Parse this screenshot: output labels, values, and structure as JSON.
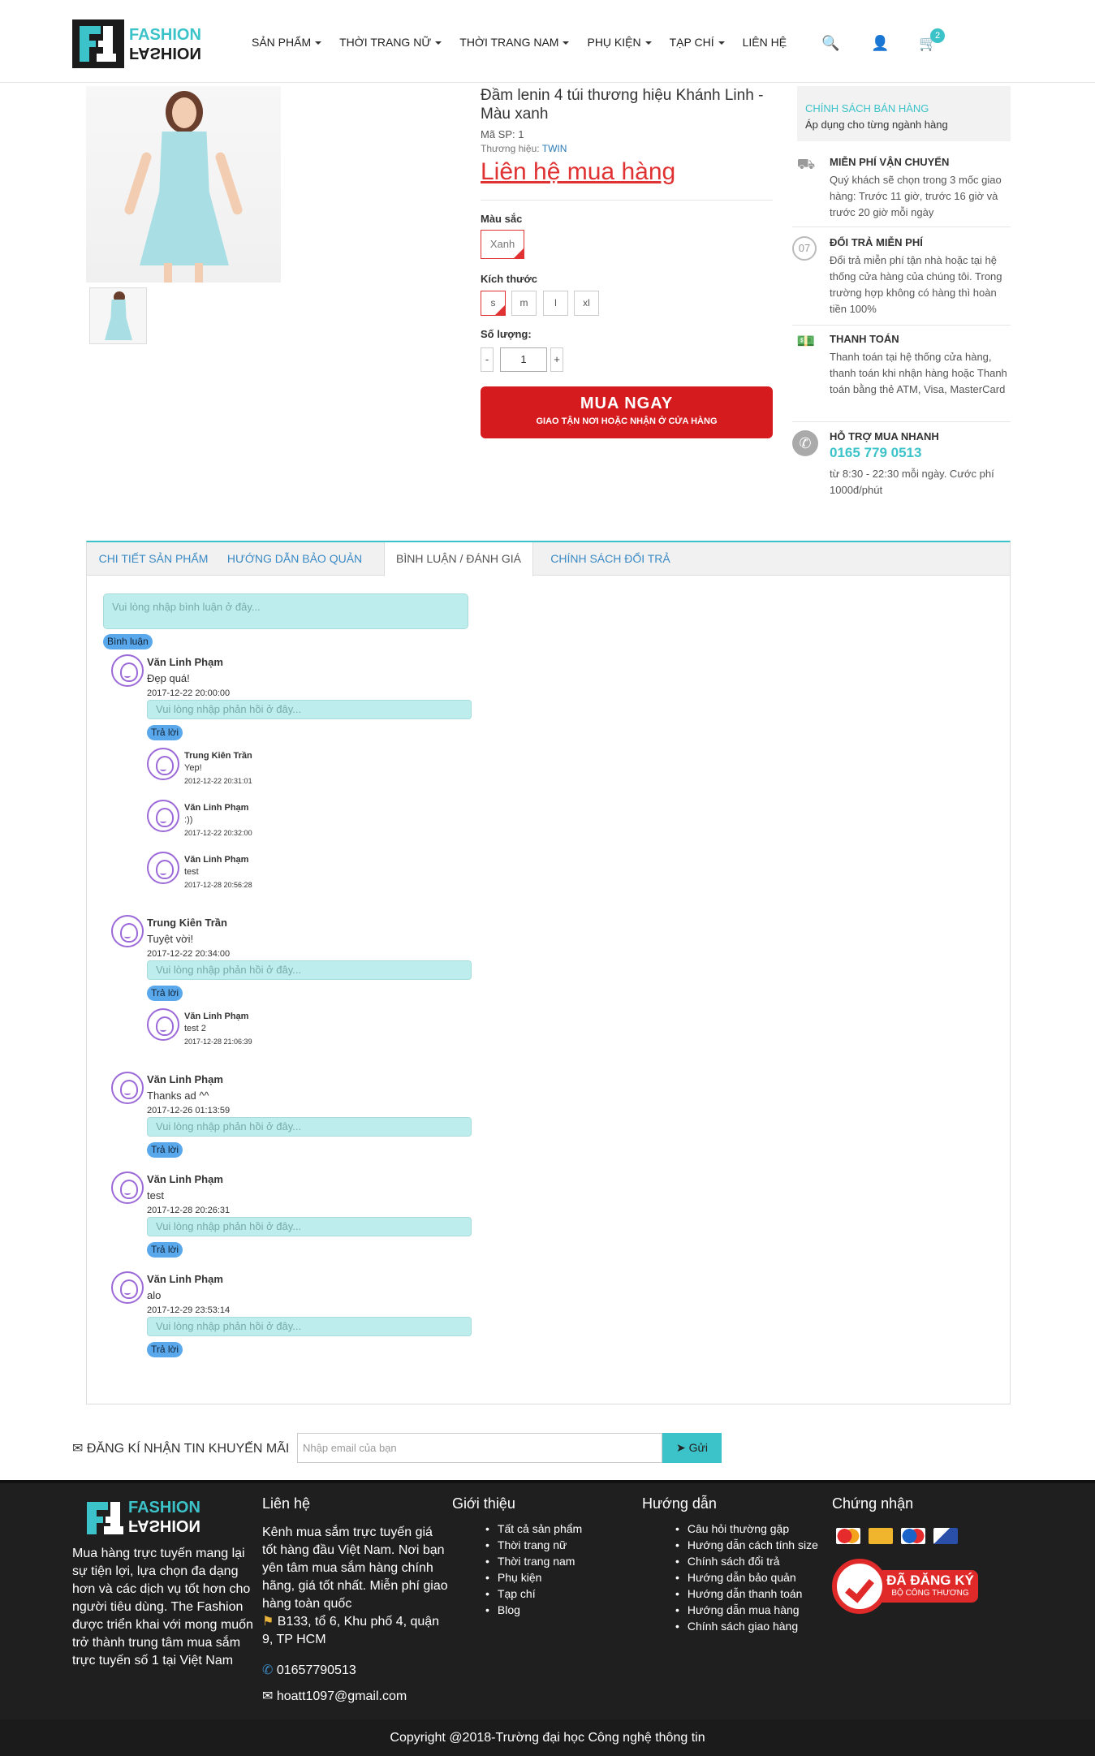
{
  "header": {
    "logo_top": "FASHION",
    "logo_bottom": "FASHION",
    "nav": [
      {
        "label": "SẢN PHẨM",
        "caret": true
      },
      {
        "label": "THỜI TRANG NỮ",
        "caret": true
      },
      {
        "label": "THỜI TRANG NAM",
        "caret": true
      },
      {
        "label": "PHỤ KIỆN",
        "caret": true
      },
      {
        "label": "TẠP CHÍ",
        "caret": true
      },
      {
        "label": "LIÊN HỆ",
        "caret": false
      }
    ],
    "cart_count": "2",
    "icons": [
      "search-icon",
      "user-icon",
      "cart-icon"
    ]
  },
  "product": {
    "title": "Đầm lenin 4 túi thương hiệu Khánh Linh - Màu xanh",
    "code": "Mã SP: 1",
    "brand_label": "Thương hiệu: ",
    "brand": "TWIN",
    "price": "Liên hệ mua hàng",
    "color_label": "Màu sắc",
    "color": "Xanh",
    "size_label": "Kích thước",
    "sizes": [
      "s",
      "m",
      "l",
      "xl"
    ],
    "qty_label": "Số lượng:",
    "qty_minus": "-",
    "qty_value": "1",
    "qty_plus": "+",
    "buy_main": "MUA NGAY",
    "buy_sub": "GIAO TẬN NƠI HOẶC NHẬN Ở CỬA HÀNG"
  },
  "policy": {
    "title": "CHÍNH SÁCH BÁN HÀNG",
    "subtitle": "Áp dụng cho từng ngành hàng",
    "items": [
      {
        "icon": "truck-icon",
        "title": "MIỄN PHÍ VẬN CHUYỂN",
        "desc": "Quý khách sẽ chọn trong 3 mốc giao hàng: Trước 11 giờ, trước 16 giờ và trước 20 giờ mỗi ngày"
      },
      {
        "icon": "return-icon",
        "title": "ĐỔI TRẢ MIỄN PHÍ",
        "desc": "Đổi trả miễn phí tận nhà hoặc tại hệ thống cửa hàng của chúng tôi. Trong trường hợp không có hàng thì hoàn tiền 100%"
      },
      {
        "icon": "payment-icon",
        "title": "THANH TOÁN",
        "desc": "Thanh toán tại hệ thống cửa hàng, thanh toán khi nhận hàng hoặc Thanh toán bằng thẻ ATM, Visa, MasterCard"
      },
      {
        "icon": "phone-icon",
        "title": "HỖ TRỢ MUA NHANH",
        "phone": "0165 779 0513",
        "desc": "từ 8:30 - 22:30 mỗi ngày. Cước phí 1000đ/phút"
      }
    ]
  },
  "tabs": [
    "CHI TIẾT SẢN PHẨM",
    "HƯỚNG DẪN BẢO QUẢN",
    "BÌNH LUẬN / ĐÁNH GIÁ",
    "CHÍNH SÁCH ĐỔI TRẢ"
  ],
  "comments_section": {
    "placeholder": "Vui lòng nhập bình luận ở đây...",
    "submit": "Bình luận",
    "reply_placeholder": "Vui lòng nhập phản hồi ở đây...",
    "reply_button": "Trả lời",
    "comments": [
      {
        "name": "Văn Linh Phạm",
        "text": "Đẹp quá!",
        "date": "2017-12-22 20:00:00",
        "replies": [
          {
            "name": "Trung Kiên Trần",
            "text": "Yep!",
            "date": "2012-12-22 20:31:01"
          },
          {
            "name": "Văn Linh Phạm",
            "text": ":))",
            "date": "2017-12-22 20:32:00"
          },
          {
            "name": "Văn Linh Phạm",
            "text": "test",
            "date": "2017-12-28 20:56:28"
          }
        ]
      },
      {
        "name": "Trung Kiên Trần",
        "text": "Tuyệt vời!",
        "date": "2017-12-22 20:34:00",
        "replies": [
          {
            "name": "Văn Linh Phạm",
            "text": "test 2",
            "date": "2017-12-28 21:06:39"
          }
        ]
      },
      {
        "name": "Văn Linh Phạm",
        "text": "Thanks ad ^^",
        "date": "2017-12-26 01:13:59",
        "replies": []
      },
      {
        "name": "Văn Linh Phạm",
        "text": "test",
        "date": "2017-12-28 20:26:31",
        "replies": []
      },
      {
        "name": "Văn Linh Phạm",
        "text": "alo",
        "date": "2017-12-29 23:53:14",
        "replies": []
      }
    ]
  },
  "newsletter": {
    "label": "ĐĂNG KÍ NHẬN TIN KHUYẾN MÃI",
    "placeholder": "Nhập email của bạn",
    "button": "Gửi"
  },
  "footer": {
    "about": "Mua hàng trực tuyến mang lại sự tiện lợi, lựa chọn đa dạng hơn và các dịch vụ tốt hơn cho người tiêu dùng. The Fashion được triển khai với mong muốn trở thành trung tâm mua sắm trực tuyến số 1 tại Việt Nam",
    "contact_title": "Liên hệ",
    "contact_desc": "Kênh mua sắm trực tuyến giá tốt hàng đầu Việt Nam. Nơi bạn yên tâm mua sắm hàng chính hãng, giá tốt nhất. Miễn phí giao hàng toàn quốc",
    "address": "B133, tổ 6, Khu phố 4, quận 9, TP HCM",
    "phone": "01657790513",
    "email": "hoatt1097@gmail.com",
    "intro_title": "Giới thiệu",
    "intro_links": [
      "Tất cả sản phẩm",
      "Thời trang nữ",
      "Thời trang nam",
      "Phụ kiện",
      "Tạp chí",
      "Blog"
    ],
    "guide_title": "Hướng dẫn",
    "guide_links": [
      "Câu hỏi thường gặp",
      "Hướng dẫn cách tính size",
      "Chính sách đổi trả",
      "Hướng dẫn bảo quản",
      "Hướng dẫn thanh toán",
      "Hướng dẫn mua hàng",
      "Chính sách giao hàng"
    ],
    "cert_title": "Chứng nhận",
    "cert_main": "ĐÃ ĐĂNG KÝ",
    "cert_sub": "BỘ CÔNG THƯƠNG",
    "copyright": "Copyright @2018-Trường đại học Công nghệ thông tin"
  },
  "colors": {
    "accent": "#3cc3c9",
    "buy": "#d61b1f",
    "price": "#e03232",
    "link": "#3a8ac5",
    "footer_bg": "#1f1f1f"
  }
}
